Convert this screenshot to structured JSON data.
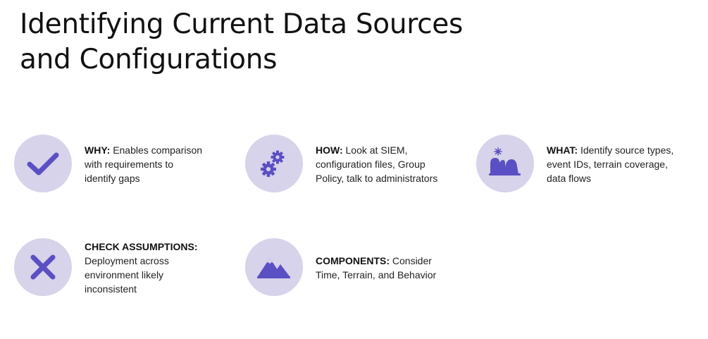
{
  "title": {
    "line1": "Identifying Current Data Sources",
    "line2": "and Configurations"
  },
  "accent_color": "#5b4fc4",
  "icon_background": "#d6d3ea",
  "items": [
    {
      "icon": "checkmark-icon",
      "label": "WHY:",
      "lines": [
        "Enables comparison",
        "with requirements to",
        "identify gaps"
      ]
    },
    {
      "icon": "gears-icon",
      "label": "HOW:",
      "lines": [
        "Look at SIEM,",
        "configuration files, Group",
        "Policy, talk to administrators"
      ]
    },
    {
      "icon": "terrain-icon",
      "label": "WHAT:",
      "lines": [
        "Identify source types,",
        "event IDs, terrain coverage,",
        "data flows"
      ]
    },
    {
      "icon": "x-mark-icon",
      "label": "CHECK ASSUMPTIONS:",
      "lines": [
        "Deployment across",
        "environment likely",
        "inconsistent"
      ]
    },
    {
      "icon": "mountains-icon",
      "label": "COMPONENTS:",
      "lines": [
        "Consider",
        "Time, Terrain, and Behavior"
      ]
    }
  ]
}
